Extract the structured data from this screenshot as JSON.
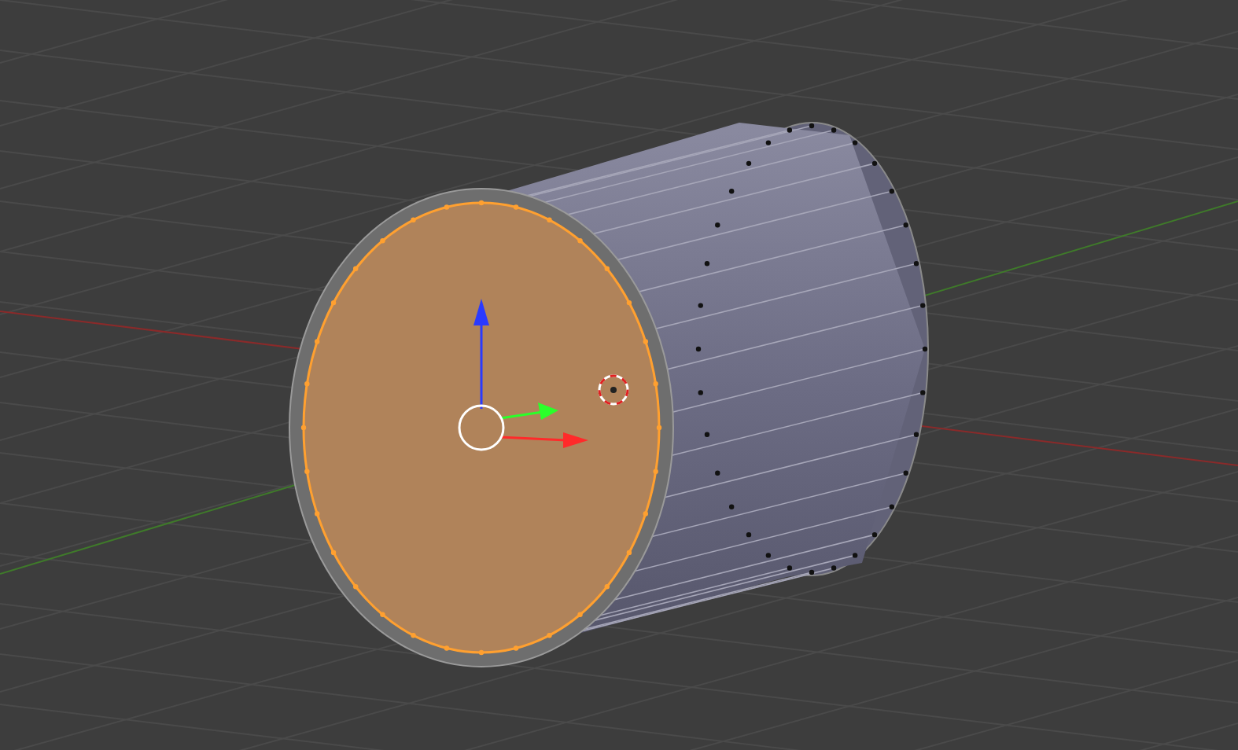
{
  "viewport": {
    "kind": "edit-mesh"
  }
}
